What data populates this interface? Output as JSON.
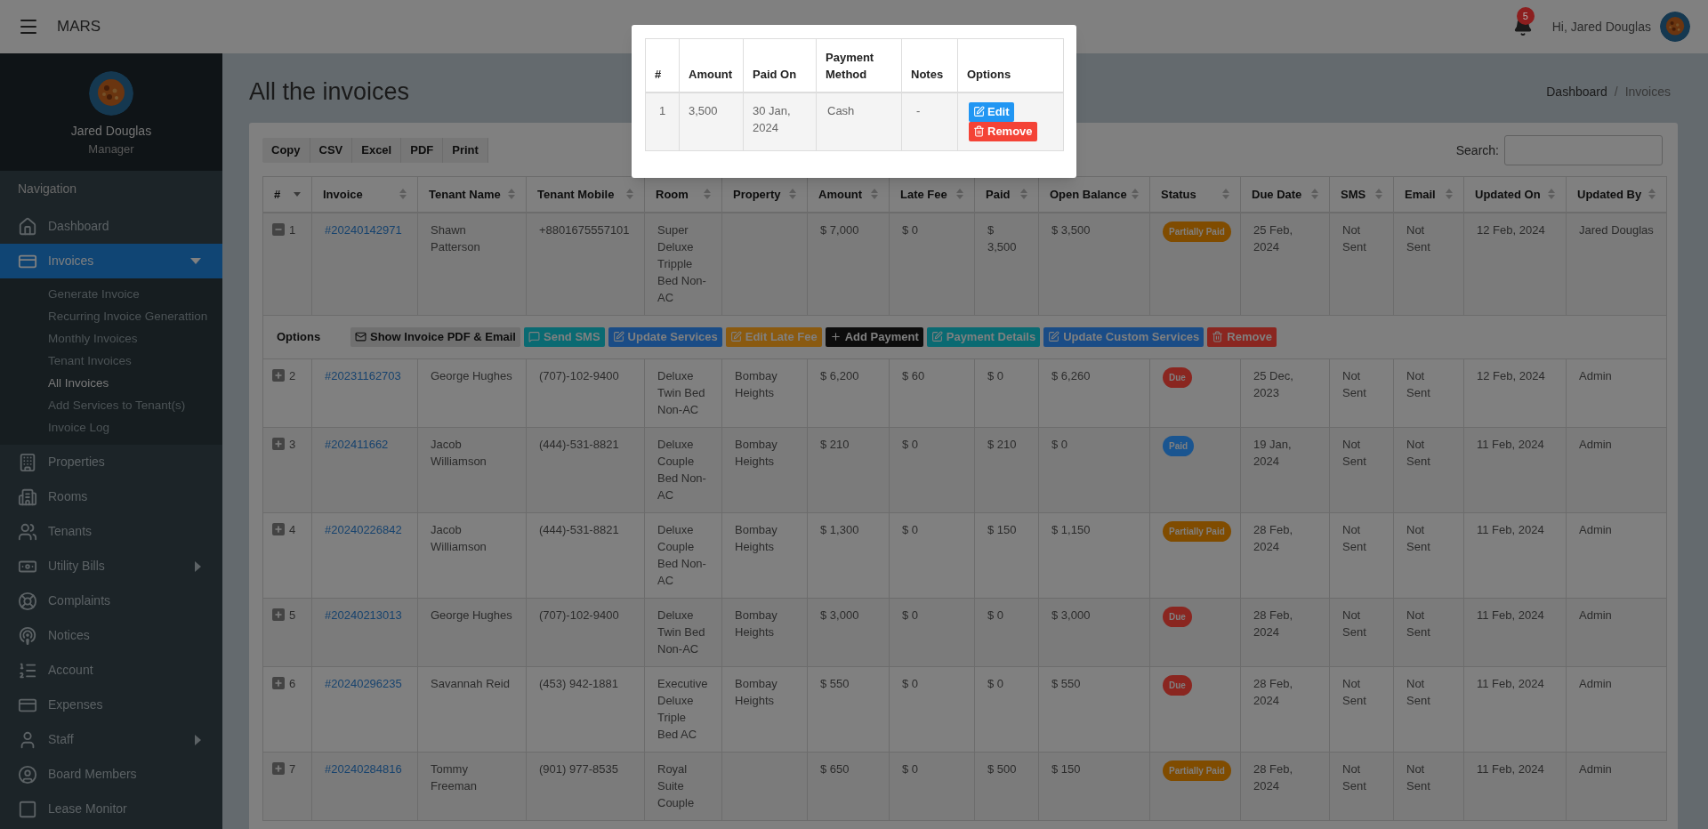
{
  "topbar": {
    "app_title": "MARS",
    "notification_count": "5",
    "greeting": "Hi, Jared Douglas"
  },
  "sidebar": {
    "user_name": "Jared Douglas",
    "user_role": "Manager",
    "section_title": "Navigation",
    "items": [
      {
        "label": "Dashboard",
        "kind": "link",
        "selected": false
      },
      {
        "label": "Invoices",
        "kind": "menu",
        "selected": true,
        "expanded": true,
        "children": [
          {
            "label": "Generate Invoice",
            "selected": false
          },
          {
            "label": "Recurring Invoice Generattion",
            "selected": false
          },
          {
            "label": "Monthly Invoices",
            "selected": false
          },
          {
            "label": "Tenant Invoices",
            "selected": false
          },
          {
            "label": "All Invoices",
            "selected": true
          },
          {
            "label": "Add Services to Tenant(s)",
            "selected": false
          },
          {
            "label": "Invoice Log",
            "selected": false
          }
        ]
      },
      {
        "label": "Properties",
        "kind": "link",
        "selected": false
      },
      {
        "label": "Rooms",
        "kind": "link",
        "selected": false
      },
      {
        "label": "Tenants",
        "kind": "link",
        "selected": false
      },
      {
        "label": "Utility Bills",
        "kind": "menu",
        "selected": false,
        "expanded": false
      },
      {
        "label": "Complaints",
        "kind": "link",
        "selected": false
      },
      {
        "label": "Notices",
        "kind": "link",
        "selected": false
      },
      {
        "label": "Account",
        "kind": "link",
        "selected": false
      },
      {
        "label": "Expenses",
        "kind": "link",
        "selected": false
      },
      {
        "label": "Staff",
        "kind": "menu",
        "selected": false,
        "expanded": false
      },
      {
        "label": "Board Members",
        "kind": "link",
        "selected": false
      },
      {
        "label": "Lease Monitor",
        "kind": "link",
        "selected": false
      }
    ]
  },
  "page": {
    "title": "All the invoices",
    "breadcrumbs": [
      "Dashboard",
      "Invoices"
    ],
    "breadcrumb_separator": "/"
  },
  "toolbar": {
    "export_buttons": [
      "Copy",
      "CSV",
      "Excel",
      "PDF",
      "Print"
    ],
    "search_label": "Search:"
  },
  "table": {
    "columns": [
      {
        "label": "#",
        "sorted": true
      },
      {
        "label": "Invoice",
        "sorted": false
      },
      {
        "label": "Tenant Name",
        "sorted": false
      },
      {
        "label": "Tenant Mobile",
        "sorted": false
      },
      {
        "label": "Room",
        "sorted": false
      },
      {
        "label": "Property",
        "sorted": false
      },
      {
        "label": "Amount",
        "sorted": false
      },
      {
        "label": "Late Fee",
        "sorted": false
      },
      {
        "label": "Paid",
        "sorted": false
      },
      {
        "label": "Open Balance",
        "sorted": false
      },
      {
        "label": "Status",
        "sorted": false
      },
      {
        "label": "Due Date",
        "sorted": false
      },
      {
        "label": "SMS",
        "sorted": false
      },
      {
        "label": "Email",
        "sorted": false
      },
      {
        "label": "Updated On",
        "sorted": false
      },
      {
        "label": "Updated By",
        "sorted": false
      }
    ],
    "rows": [
      {
        "expanded": true,
        "number": "1",
        "invoice": "#20240142971",
        "tenant_name": "Shawn Patterson",
        "tenant_mobile": "+8801675557101",
        "room": "Super Deluxe Tripple Bed Non-AC",
        "amount": "$ 7,000",
        "late_fee": "$ 0",
        "paid": "$ 3,500",
        "open_balance": "$ 3,500",
        "status": {
          "label": "Partially Paid",
          "color": "#804c00"
        },
        "due_date": "25 Feb, 2024",
        "sms": "Not Sent",
        "email": "Not Sent",
        "updated_on": "12 Feb, 2024",
        "updated_by": "Jared Douglas",
        "options": {
          "label": "Options",
          "actions": [
            {
              "label": "Show Invoice PDF & Email",
              "color": "#707070"
            },
            {
              "label": "Send SMS",
              "color": "#0a6a72"
            },
            {
              "label": "Update Services",
              "color": "#1a4c86"
            },
            {
              "label": "Edit Late Fee",
              "color": "#8a5a10"
            },
            {
              "label": "Add Payment",
              "color": "#0d0d0d"
            },
            {
              "label": "Payment Details",
              "color": "#0a6a72"
            },
            {
              "label": "Update Custom Services",
              "color": "#1a4c86"
            },
            {
              "label": "Remove",
              "color": "#8a2620"
            }
          ]
        }
      },
      {
        "expanded": false,
        "number": "2",
        "invoice": "#20231162703",
        "tenant_name": "George Hughes",
        "tenant_mobile": "(707)-102-9400",
        "room": "Deluxe Twin Bed Non-AC",
        "property": "Bombay Heights",
        "amount": "$ 6,200",
        "late_fee": "$ 60",
        "paid": "$ 0",
        "open_balance": "$ 6,260",
        "status": {
          "label": "Due",
          "color": "#8a2620"
        },
        "due_date": "25 Dec, 2023",
        "sms": "Not Sent",
        "email": "Not Sent",
        "updated_on": "12 Feb, 2024",
        "updated_by": "Admin"
      },
      {
        "expanded": false,
        "number": "3",
        "invoice": "#202411662",
        "tenant_name": "Jacob Williamson",
        "tenant_mobile": "(444)-531-8821",
        "room": "Deluxe Couple Bed Non-AC",
        "property": "Bombay Heights",
        "amount": "$ 210",
        "late_fee": "$ 0",
        "paid": "$ 210",
        "open_balance": "$ 0",
        "status": {
          "label": "Paid",
          "color": "#1a5590"
        },
        "due_date": "19 Jan, 2024",
        "sms": "Not Sent",
        "email": "Not Sent",
        "updated_on": "11 Feb, 2024",
        "updated_by": "Admin"
      },
      {
        "expanded": false,
        "number": "4",
        "invoice": "#20240226842",
        "tenant_name": "Jacob Williamson",
        "tenant_mobile": "(444)-531-8821",
        "room": "Deluxe Couple Bed Non-AC",
        "property": "Bombay Heights",
        "amount": "$ 1,300",
        "late_fee": "$ 0",
        "paid": "$ 150",
        "open_balance": "$ 1,150",
        "status": {
          "label": "Partially Paid",
          "color": "#804c00"
        },
        "due_date": "28 Feb, 2024",
        "sms": "Not Sent",
        "email": "Not Sent",
        "updated_on": "11 Feb, 2024",
        "updated_by": "Admin"
      },
      {
        "expanded": false,
        "number": "5",
        "invoice": "#20240213013",
        "tenant_name": "George Hughes",
        "tenant_mobile": "(707)-102-9400",
        "room": "Deluxe Twin Bed Non-AC",
        "property": "Bombay Heights",
        "amount": "$ 3,000",
        "late_fee": "$ 0",
        "paid": "$ 0",
        "open_balance": "$ 3,000",
        "status": {
          "label": "Due",
          "color": "#8a2620"
        },
        "due_date": "28 Feb, 2024",
        "sms": "Not Sent",
        "email": "Not Sent",
        "updated_on": "11 Feb, 2024",
        "updated_by": "Admin"
      },
      {
        "expanded": false,
        "number": "6",
        "invoice": "#20240296235",
        "tenant_name": "Savannah Reid",
        "tenant_mobile": "(453) 942-1881",
        "room": "Executive Deluxe Triple Bed AC",
        "property": "Bombay Heights",
        "amount": "$ 550",
        "late_fee": "$ 0",
        "paid": "$ 0",
        "open_balance": "$ 550",
        "status": {
          "label": "Due",
          "color": "#8a2620"
        },
        "due_date": "28 Feb, 2024",
        "sms": "Not Sent",
        "email": "Not Sent",
        "updated_on": "11 Feb, 2024",
        "updated_by": "Admin"
      },
      {
        "expanded": false,
        "number": "7",
        "invoice": "#20240284816",
        "tenant_name": "Tommy Freeman",
        "tenant_mobile": "(901) 977-8535",
        "room": "Royal Suite Couple",
        "amount": "$ 650",
        "late_fee": "$ 0",
        "paid": "$ 500",
        "open_balance": "$ 150",
        "status": {
          "label": "Partially Paid",
          "color": "#804c00"
        },
        "due_date": "28 Feb, 2024",
        "sms": "Not Sent",
        "email": "Not Sent",
        "updated_on": "11 Feb, 2024",
        "updated_by": "Admin"
      }
    ]
  },
  "modal": {
    "columns": [
      "#",
      "Amount",
      "Paid On",
      "Payment Method",
      "Notes",
      "Options"
    ],
    "rows": [
      {
        "number": "1",
        "amount": "3,500",
        "paid_on": "30 Jan, 2024",
        "payment_method": "Cash",
        "notes": "-",
        "actions": [
          {
            "label": "Edit",
            "color": "#2196f3"
          },
          {
            "label": "Remove",
            "color": "#f44336"
          }
        ]
      }
    ]
  }
}
